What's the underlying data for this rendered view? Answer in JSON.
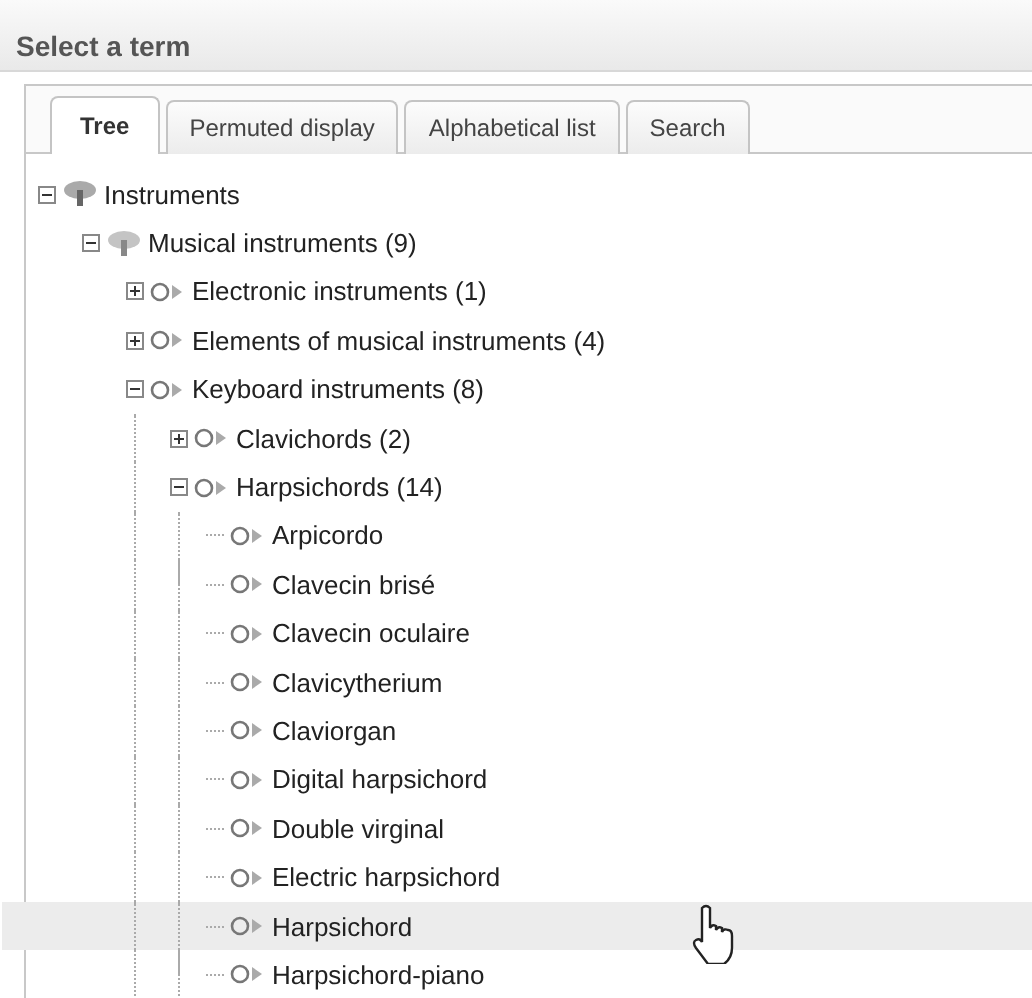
{
  "window": {
    "title": "Select a term"
  },
  "tabs": [
    {
      "label": "Tree",
      "selected": true
    },
    {
      "label": "Permuted display",
      "selected": false
    },
    {
      "label": "Alphabetical list",
      "selected": false
    },
    {
      "label": "Search",
      "selected": false
    }
  ],
  "tree": [
    {
      "label": "Instruments",
      "kind": "facet",
      "expanded": true,
      "selected": false,
      "children": [
        {
          "label": "Musical instruments (9)",
          "kind": "facet",
          "expanded": true,
          "selected": false,
          "children": [
            {
              "label": "Electronic instruments (1)",
              "kind": "term",
              "expanded": false,
              "selected": false
            },
            {
              "label": "Elements of musical instruments (4)",
              "kind": "term",
              "expanded": false,
              "selected": false
            },
            {
              "label": "Keyboard instruments (8)",
              "kind": "term",
              "expanded": true,
              "selected": false,
              "children": [
                {
                  "label": "Clavichords (2)",
                  "kind": "term",
                  "expanded": false,
                  "selected": false
                },
                {
                  "label": "Harpsichords (14)",
                  "kind": "term",
                  "expanded": true,
                  "selected": false,
                  "children": [
                    {
                      "label": "Arpicordo",
                      "kind": "term",
                      "selected": false
                    },
                    {
                      "label": "Clavecin brisé",
                      "kind": "term",
                      "selected": false
                    },
                    {
                      "label": "Clavecin oculaire",
                      "kind": "term",
                      "selected": false
                    },
                    {
                      "label": "Clavicytherium",
                      "kind": "term",
                      "selected": false
                    },
                    {
                      "label": "Claviorgan",
                      "kind": "term",
                      "selected": false
                    },
                    {
                      "label": "Digital harpsichord",
                      "kind": "term",
                      "selected": false
                    },
                    {
                      "label": "Double virginal",
                      "kind": "term",
                      "selected": false
                    },
                    {
                      "label": "Electric harpsichord",
                      "kind": "term",
                      "selected": false
                    },
                    {
                      "label": "Harpsichord",
                      "kind": "term",
                      "selected": true
                    },
                    {
                      "label": "Harpsichord-piano",
                      "kind": "term",
                      "selected": false
                    }
                  ]
                }
              ]
            }
          ]
        }
      ]
    }
  ]
}
